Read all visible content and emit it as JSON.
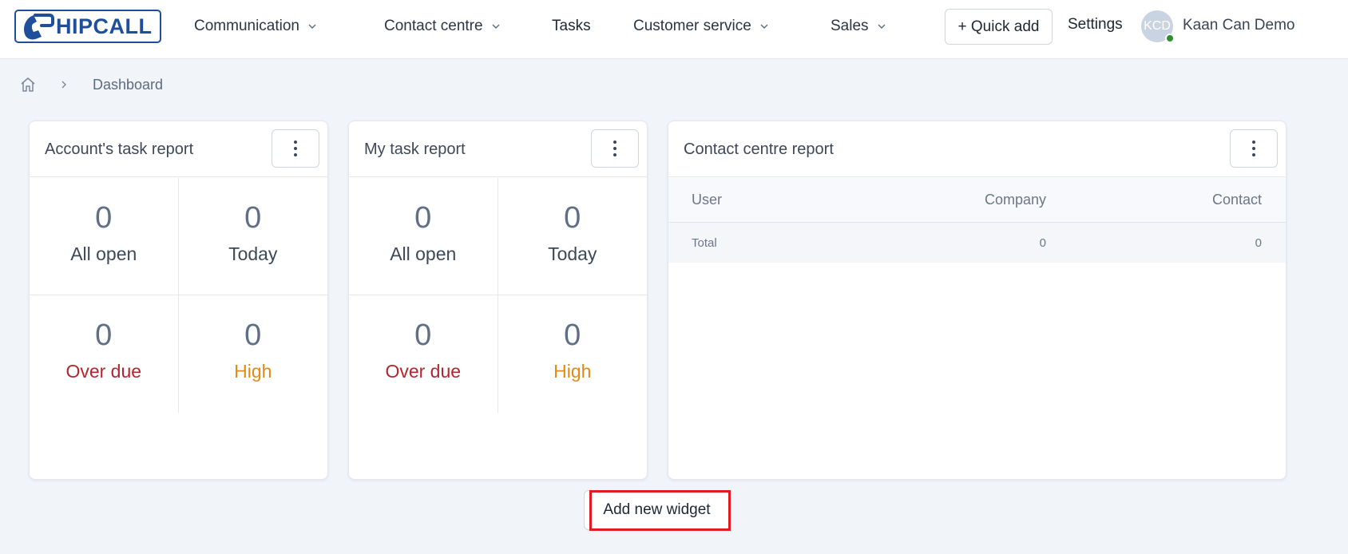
{
  "app": {
    "logo_text": "HIPCALL"
  },
  "nav": {
    "items": [
      {
        "label": "Communication",
        "has_dropdown": true
      },
      {
        "label": "Contact centre",
        "has_dropdown": true
      },
      {
        "label": "Tasks",
        "has_dropdown": false
      },
      {
        "label": "Customer service",
        "has_dropdown": true
      },
      {
        "label": "Sales",
        "has_dropdown": true
      }
    ],
    "quick_add": "+ Quick add",
    "settings": "Settings",
    "user": {
      "initials": "KCD",
      "name": "Kaan Can Demo",
      "status_color": "#2f8f2f"
    }
  },
  "breadcrumb": {
    "home_icon": "home-icon",
    "current": "Dashboard"
  },
  "widgets": {
    "account_task_report": {
      "title": "Account's task report",
      "stats": [
        {
          "value": "0",
          "label": "All open"
        },
        {
          "value": "0",
          "label": "Today"
        },
        {
          "value": "0",
          "label": "Over due"
        },
        {
          "value": "0",
          "label": "High"
        }
      ]
    },
    "my_task_report": {
      "title": "My task report",
      "stats": [
        {
          "value": "0",
          "label": "All open"
        },
        {
          "value": "0",
          "label": "Today"
        },
        {
          "value": "0",
          "label": "Over due"
        },
        {
          "value": "0",
          "label": "High"
        }
      ]
    },
    "contact_centre_report": {
      "title": "Contact centre report",
      "columns": [
        "User",
        "Company",
        "Contact"
      ],
      "rows": [
        [
          "Total",
          "0",
          "0"
        ]
      ]
    }
  },
  "add_widget": "Add new widget",
  "colors": {
    "accent": "#1f4e9a",
    "overdue": "#b3262d",
    "high": "#e38916",
    "highlight": "#e21b23"
  }
}
